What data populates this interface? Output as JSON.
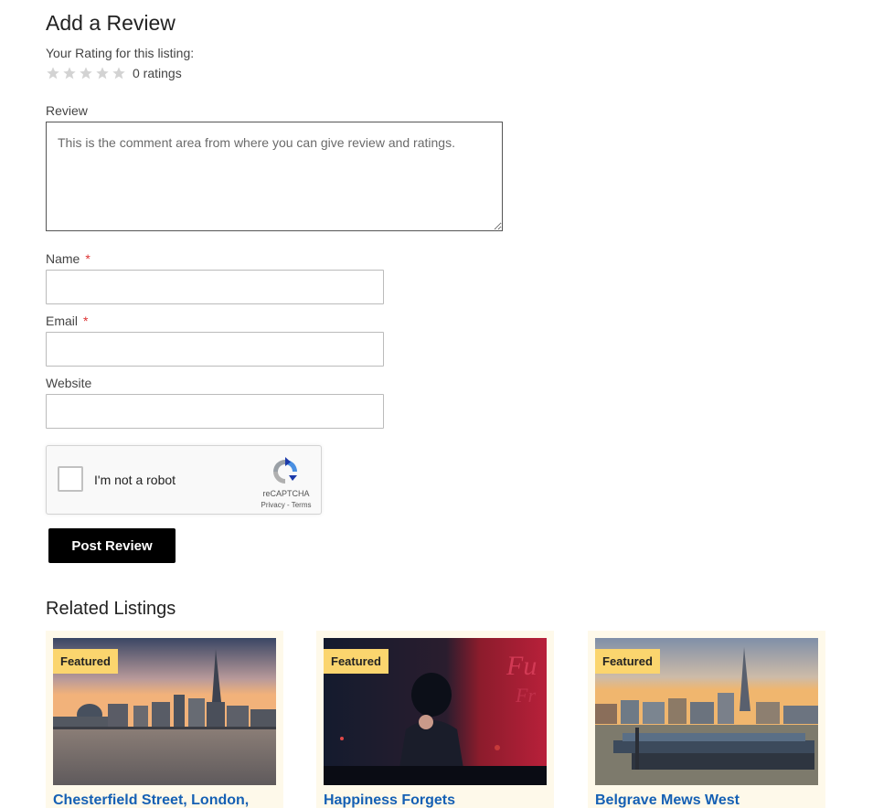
{
  "review_form": {
    "title": "Add a Review",
    "rating_label": "Your Rating for this listing:",
    "rating": {
      "value": 0,
      "max": 5
    },
    "ratings_count": "0 ratings",
    "review_label": "Review",
    "review_placeholder": "This is the comment area from where you can give review and ratings.",
    "name_label": "Name",
    "email_label": "Email",
    "website_label": "Website",
    "required_mark": "*",
    "captcha": {
      "text": "I'm not a robot",
      "brand": "reCAPTCHA",
      "links": "Privacy - Terms"
    },
    "submit_label": "Post Review"
  },
  "related": {
    "title": "Related Listings",
    "listings": [
      {
        "badge": "Featured",
        "name": "Chesterfield Street, London,"
      },
      {
        "badge": "Featured",
        "name": "Happiness Forgets"
      },
      {
        "badge": "Featured",
        "name": "Belgrave Mews West"
      }
    ]
  },
  "colors": {
    "accent_link": "#1560b4",
    "badge_bg": "#fbd56e",
    "card_bg": "#fef9ea",
    "button_bg": "#000000",
    "required": "#dd3333"
  }
}
